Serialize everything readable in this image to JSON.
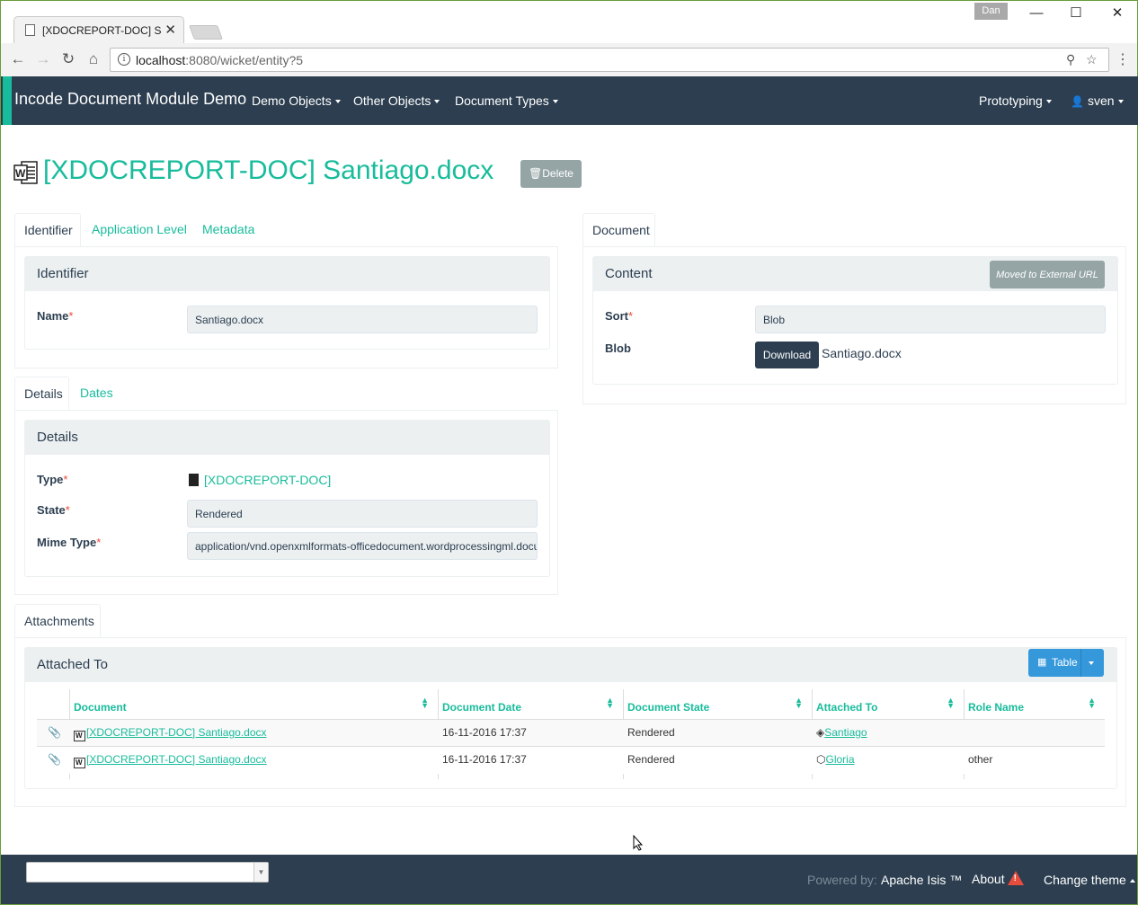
{
  "browser": {
    "tab_title": "[XDOCREPORT-DOC] San",
    "user_badge": "Dan",
    "url_host": "localhost",
    "url_rest": ":8080/wicket/entity?5"
  },
  "navbar": {
    "brand": "Incode Document Module Demo",
    "menus": [
      "Demo Objects",
      "Other Objects",
      "Document Types"
    ],
    "prototyping": "Prototyping",
    "user": "sven"
  },
  "header": {
    "title": "[XDOCREPORT-DOC] Santiago.docx",
    "delete_label": "Delete"
  },
  "identifier_tabs": [
    "Identifier",
    "Application Level",
    "Metadata"
  ],
  "identifier_panel": {
    "heading": "Identifier",
    "name_label": "Name",
    "name_value": "Santiago.docx"
  },
  "details_tabs": [
    "Details",
    "Dates"
  ],
  "details_panel": {
    "heading": "Details",
    "type_label": "Type",
    "type_value": "[XDOCREPORT-DOC]",
    "state_label": "State",
    "state_value": "Rendered",
    "mime_label": "Mime Type",
    "mime_value": "application/vnd.openxmlformats-officedocument.wordprocessingml.document"
  },
  "document_tabs": [
    "Document"
  ],
  "content_panel": {
    "heading": "Content",
    "moved_button": "Moved to External URL",
    "sort_label": "Sort",
    "sort_value": "Blob",
    "blob_label": "Blob",
    "download_label": "Download",
    "blob_filename": "Santiago.docx"
  },
  "attachments_tabs": [
    "Attachments"
  ],
  "attached_panel": {
    "heading": "Attached To",
    "table_button": "Table",
    "columns": [
      "Document",
      "Document Date",
      "Document State",
      "Attached To",
      "Role Name"
    ],
    "rows": [
      {
        "document": "[XDOCREPORT-DOC] Santiago.docx",
        "date": "16-11-2016 17:37",
        "state": "Rendered",
        "attached_to": "Santiago",
        "role": ""
      },
      {
        "document": "[XDOCREPORT-DOC] Santiago.docx",
        "date": "16-11-2016 17:37",
        "state": "Rendered",
        "attached_to": "Gloria",
        "role": "other"
      }
    ]
  },
  "footer": {
    "powered_by": "Powered by:",
    "framework": "Apache Isis ™",
    "about": "About",
    "change_theme": "Change theme"
  },
  "colors": {
    "navbar": "#2c3e50",
    "accent": "#18bc9c",
    "primary_button": "#3498db",
    "muted_button": "#95a5a6",
    "required": "#e74c3c"
  }
}
